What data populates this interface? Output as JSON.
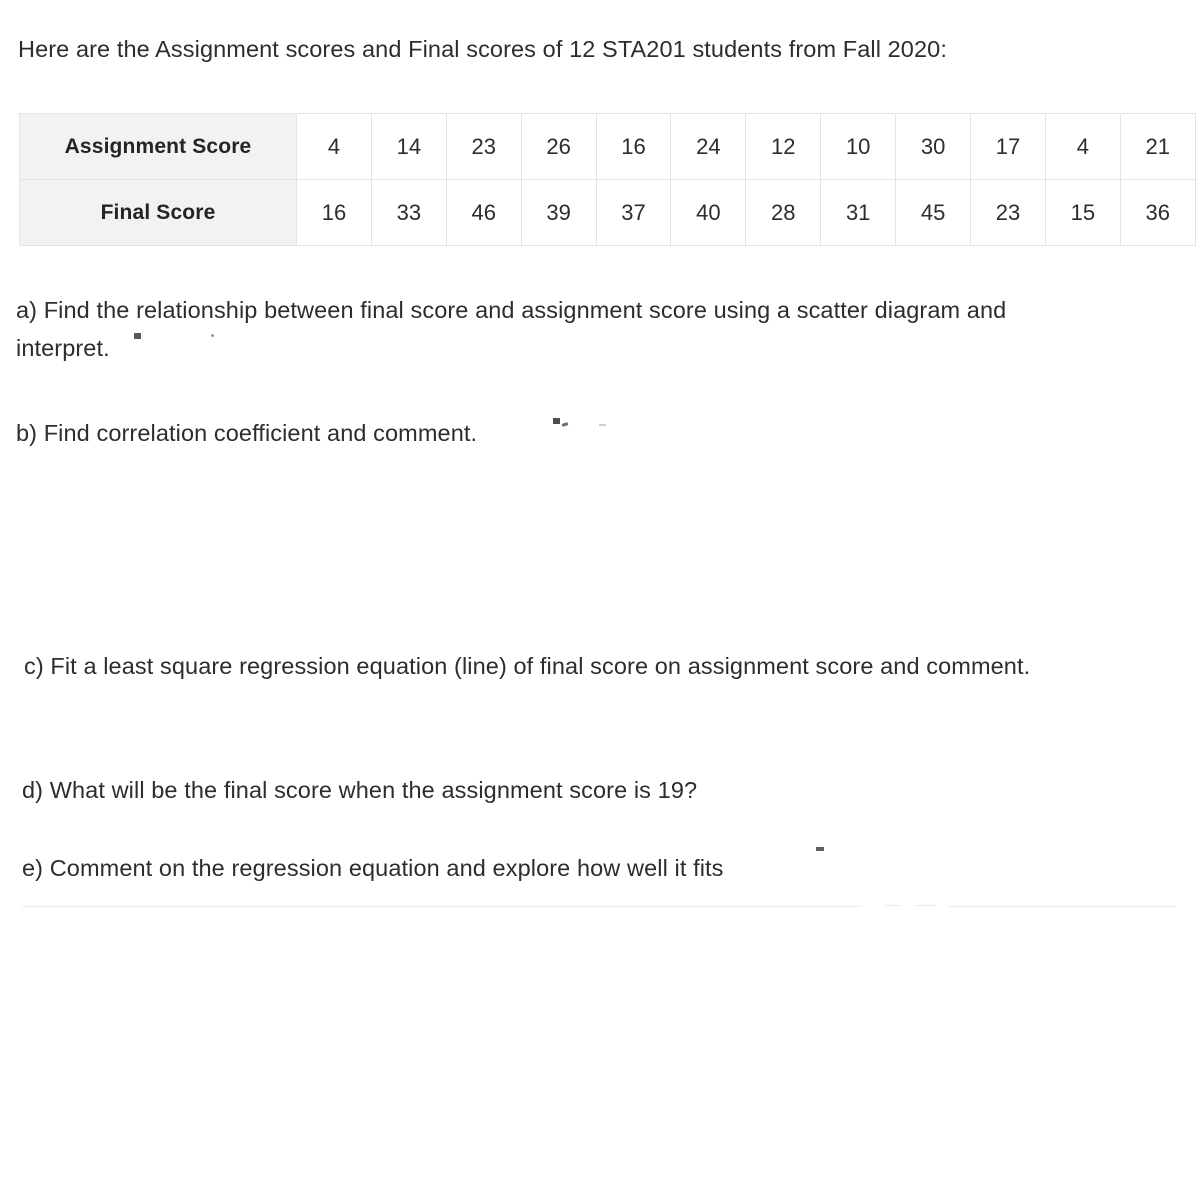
{
  "document": {
    "intro": "Here are the Assignment scores and Final scores of 12 STA201 students from Fall 2020:"
  },
  "table": {
    "row_labels": [
      "Assignment Score",
      "Final Score"
    ],
    "assignment_scores": [
      4,
      14,
      23,
      26,
      16,
      24,
      12,
      10,
      30,
      17,
      4,
      21
    ],
    "final_scores": [
      16,
      33,
      46,
      39,
      37,
      40,
      28,
      31,
      45,
      23,
      15,
      36
    ],
    "student_count": 12,
    "header_background": "#f2f2f2",
    "border_color": "#e3e3e3"
  },
  "questions": {
    "a_line1": "a) Find the relationship between final score and assignment score using a scatter diagram and",
    "a_line2": "interpret.",
    "b": "b) Find correlation coefficient and comment.",
    "c": "c) Fit a least square regression equation (line) of final score on assignment score and comment.",
    "d": "d) What will be the final score when the assignment score is 19?",
    "e": "e) Comment on the regression equation and explore how well it fits"
  },
  "chart_data": {
    "type": "table",
    "title": "Assignment scores and Final scores of 12 STA201 students from Fall 2020",
    "categories": [
      "Assignment Score",
      "Final Score"
    ],
    "x": [
      4,
      14,
      23,
      26,
      16,
      24,
      12,
      10,
      30,
      17,
      4,
      21
    ],
    "series": [
      {
        "name": "Assignment Score",
        "values": [
          4,
          14,
          23,
          26,
          16,
          24,
          12,
          10,
          30,
          17,
          4,
          21
        ]
      },
      {
        "name": "Final Score",
        "values": [
          16,
          33,
          46,
          39,
          37,
          40,
          28,
          31,
          45,
          23,
          15,
          36
        ]
      }
    ],
    "xlabel": "Assignment Score",
    "ylabel": "Final Score",
    "grid": true,
    "legend": "none"
  }
}
